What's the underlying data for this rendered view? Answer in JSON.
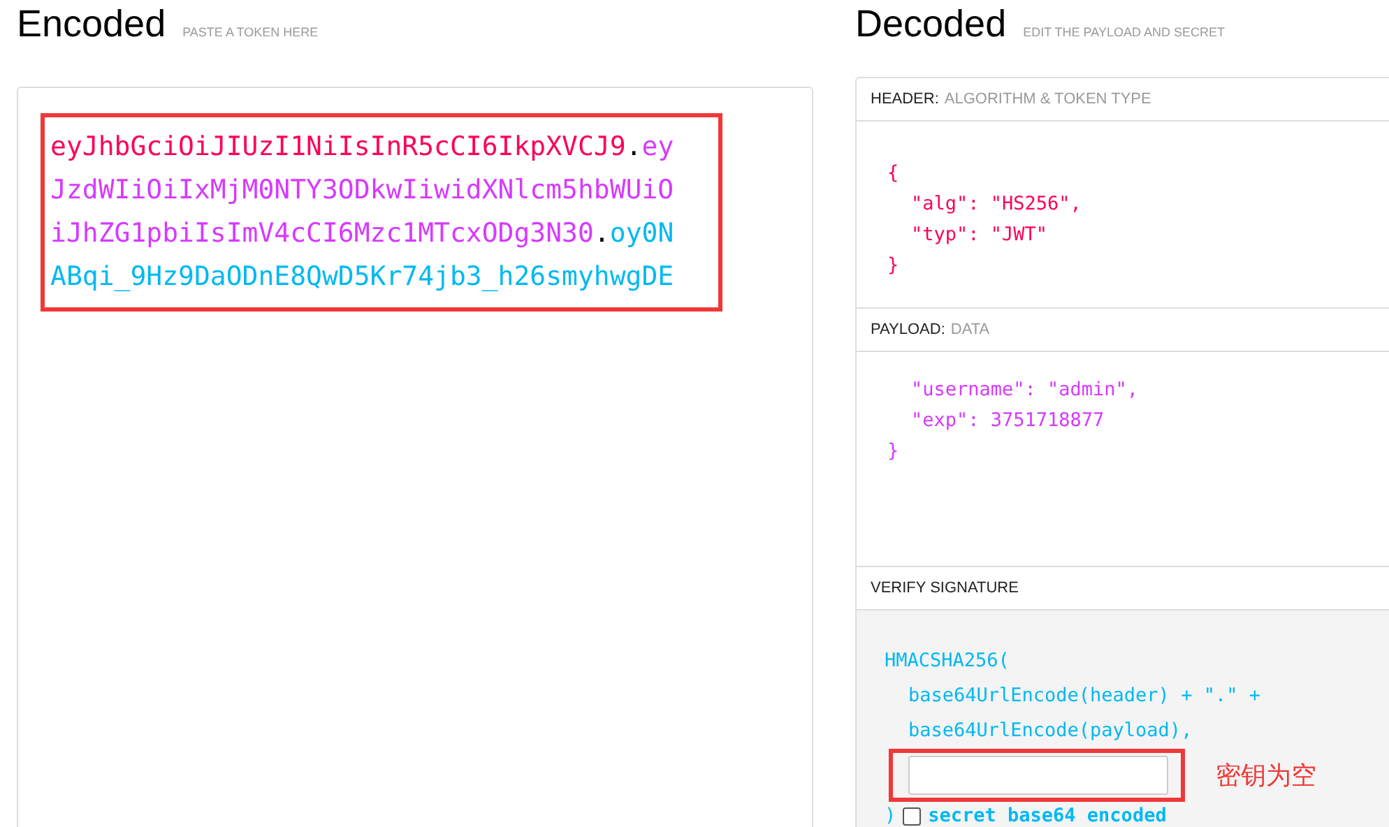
{
  "encoded": {
    "title": "Encoded",
    "subtitle": "PASTE A TOKEN HERE",
    "token": [
      {
        "kind": "header",
        "text": "eyJhbGciOiJIUzI1NiIsInR5cCI6IkpXVCJ9"
      },
      {
        "kind": "dot",
        "text": "."
      },
      {
        "kind": "payload",
        "text": "eyJzdWIiOiIxMjM0NTY3ODkwIiwidXNlcm5hbWUiOiJhZG1pbiIsImV4cCI6Mzc1MTcxODg3N30"
      },
      {
        "kind": "dot",
        "text": "."
      },
      {
        "kind": "signature",
        "text": "oy0NABqi_9Hz9DaODnE8QwD5Kr74jb3_h26smyhwgDE"
      }
    ]
  },
  "decoded": {
    "title": "Decoded",
    "subtitle": "EDIT THE PAYLOAD AND SECRET",
    "sections": [
      {
        "kind": "header",
        "label": "HEADER:",
        "hint": "ALGORITHM & TOKEN TYPE",
        "lines": [
          {
            "kind": "brace",
            "text": "{"
          },
          {
            "kind": "entry",
            "text": "\"alg\": \"HS256\","
          },
          {
            "kind": "entry",
            "text": "\"typ\": \"JWT\""
          },
          {
            "kind": "brace",
            "text": "}"
          }
        ]
      },
      {
        "kind": "payload",
        "label": "PAYLOAD:",
        "hint": "DATA",
        "lines": [
          {
            "kind": "entry",
            "text": "\"username\": \"admin\","
          },
          {
            "kind": "entry",
            "text": "\"exp\": 3751718877"
          },
          {
            "kind": "brace",
            "text": "}"
          }
        ]
      }
    ],
    "verify": {
      "label": "VERIFY SIGNATURE",
      "lines": [
        {
          "kind": "call",
          "text": "HMACSHA256("
        },
        {
          "kind": "arg",
          "text": "base64UrlEncode(header) + \".\" +"
        },
        {
          "kind": "arg",
          "text": "base64UrlEncode(payload),"
        }
      ],
      "annotation": "密钥为空",
      "close": ")",
      "base64": {
        "label": "secret base64 encoded",
        "checked": false
      }
    }
  }
}
